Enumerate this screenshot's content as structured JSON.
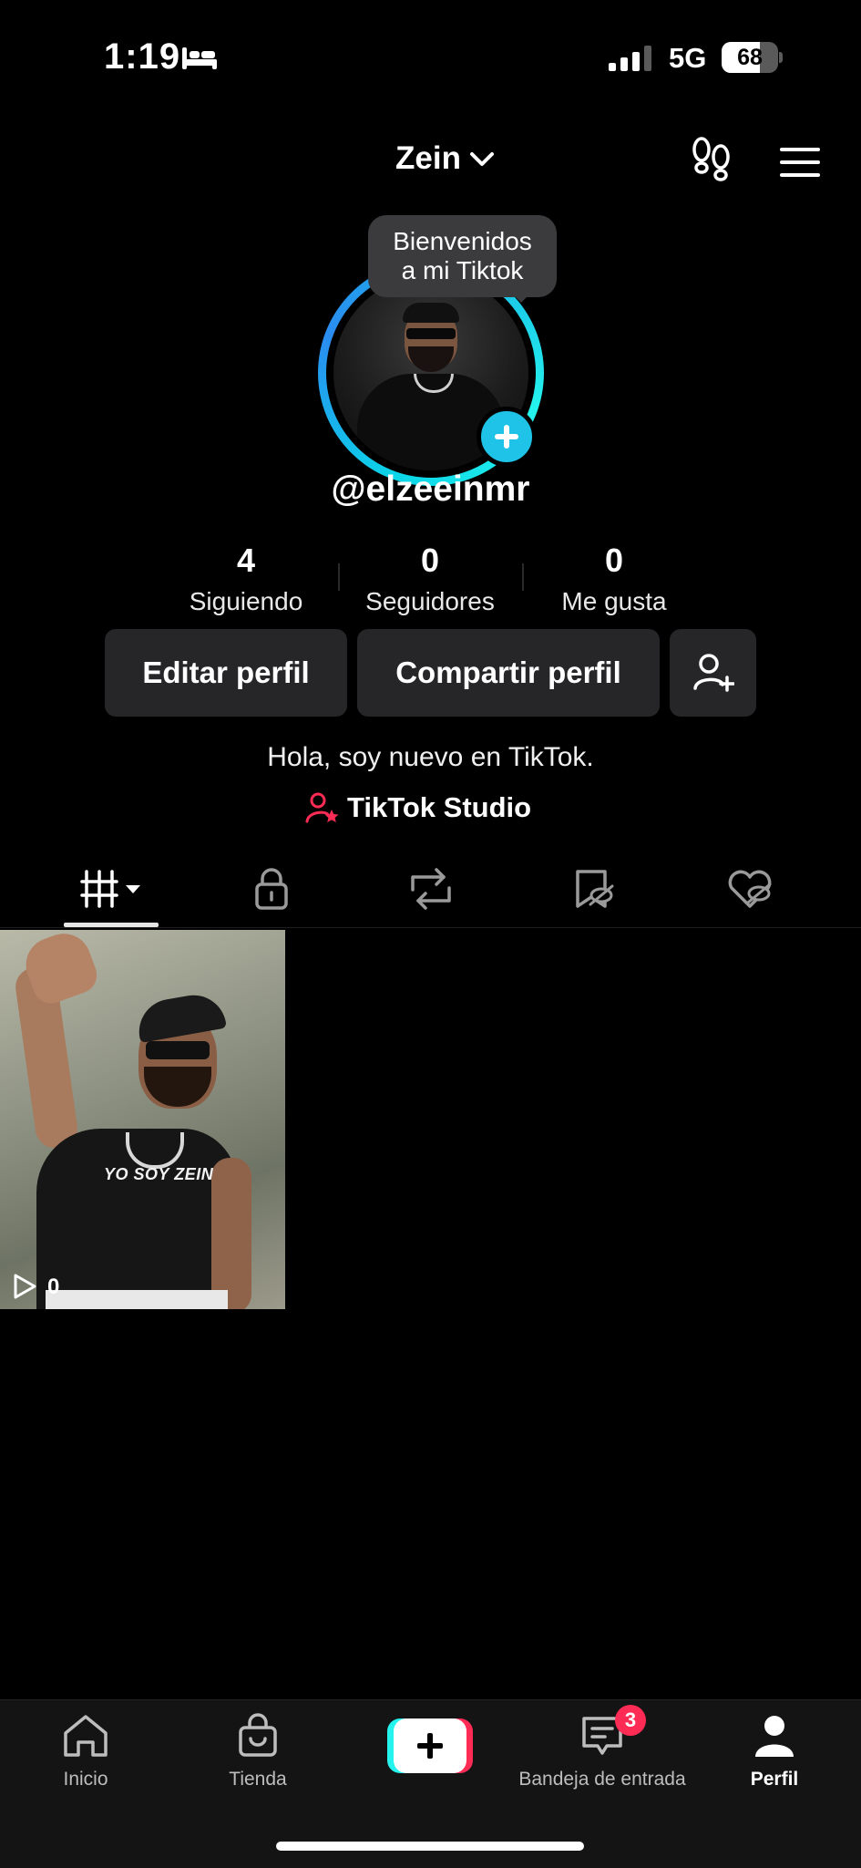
{
  "status_bar": {
    "time": "1:19",
    "network": "5G",
    "battery": "68",
    "battery_level": 0.68
  },
  "header": {
    "account_name": "Zein"
  },
  "profile": {
    "tooltip_line1": "Bienvenidos",
    "tooltip_line2": "a mi Tiktok",
    "handle": "@elzeeinmr",
    "stats": [
      {
        "value": "4",
        "label": "Siguiendo"
      },
      {
        "value": "0",
        "label": "Seguidores"
      },
      {
        "value": "0",
        "label": "Me gusta"
      }
    ],
    "edit_label": "Editar perfil",
    "share_label": "Compartir perfil",
    "bio": "Hola, soy nuevo en TikTok.",
    "studio_label": "TikTok Studio"
  },
  "videos": [
    {
      "overlay_text": "YO SOY ZEIN",
      "views": "0"
    }
  ],
  "bottom_nav": {
    "home": "Inicio",
    "shop": "Tienda",
    "inbox": "Bandeja de entrada",
    "inbox_badge": "3",
    "profile": "Perfil"
  },
  "colors": {
    "accent_pink": "#fe2c55",
    "accent_cyan": "#25f4ee",
    "story_ring": "#20c3e8"
  }
}
